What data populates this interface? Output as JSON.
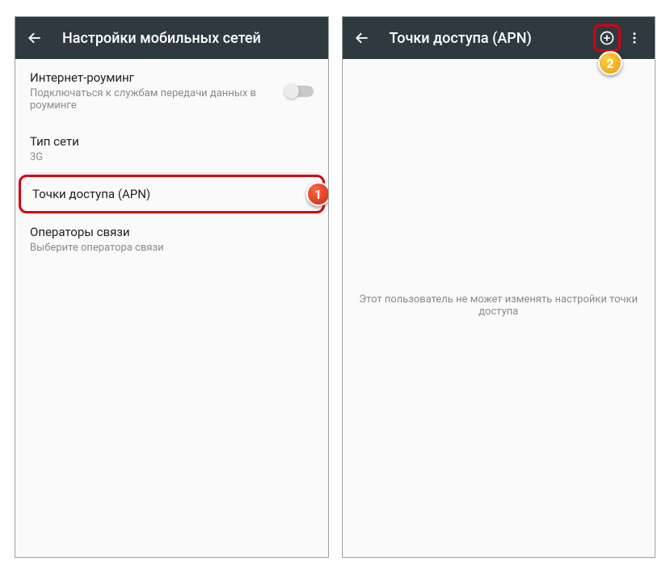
{
  "left": {
    "title": "Настройки мобильных сетей",
    "rows": {
      "roaming": {
        "label": "Интернет-роуминг",
        "sublabel": "Подключаться к службам передачи данных в роуминге"
      },
      "network_type": {
        "label": "Тип сети",
        "sublabel": "3G"
      },
      "apn": {
        "label": "Точки доступа (APN)"
      },
      "operators": {
        "label": "Операторы связи",
        "sublabel": "Выберите оператора связи"
      }
    },
    "badge": "1"
  },
  "right": {
    "title": "Точки доступа (APN)",
    "empty_message": "Этот пользователь не может изменять настройки точки доступа",
    "badge": "2"
  }
}
